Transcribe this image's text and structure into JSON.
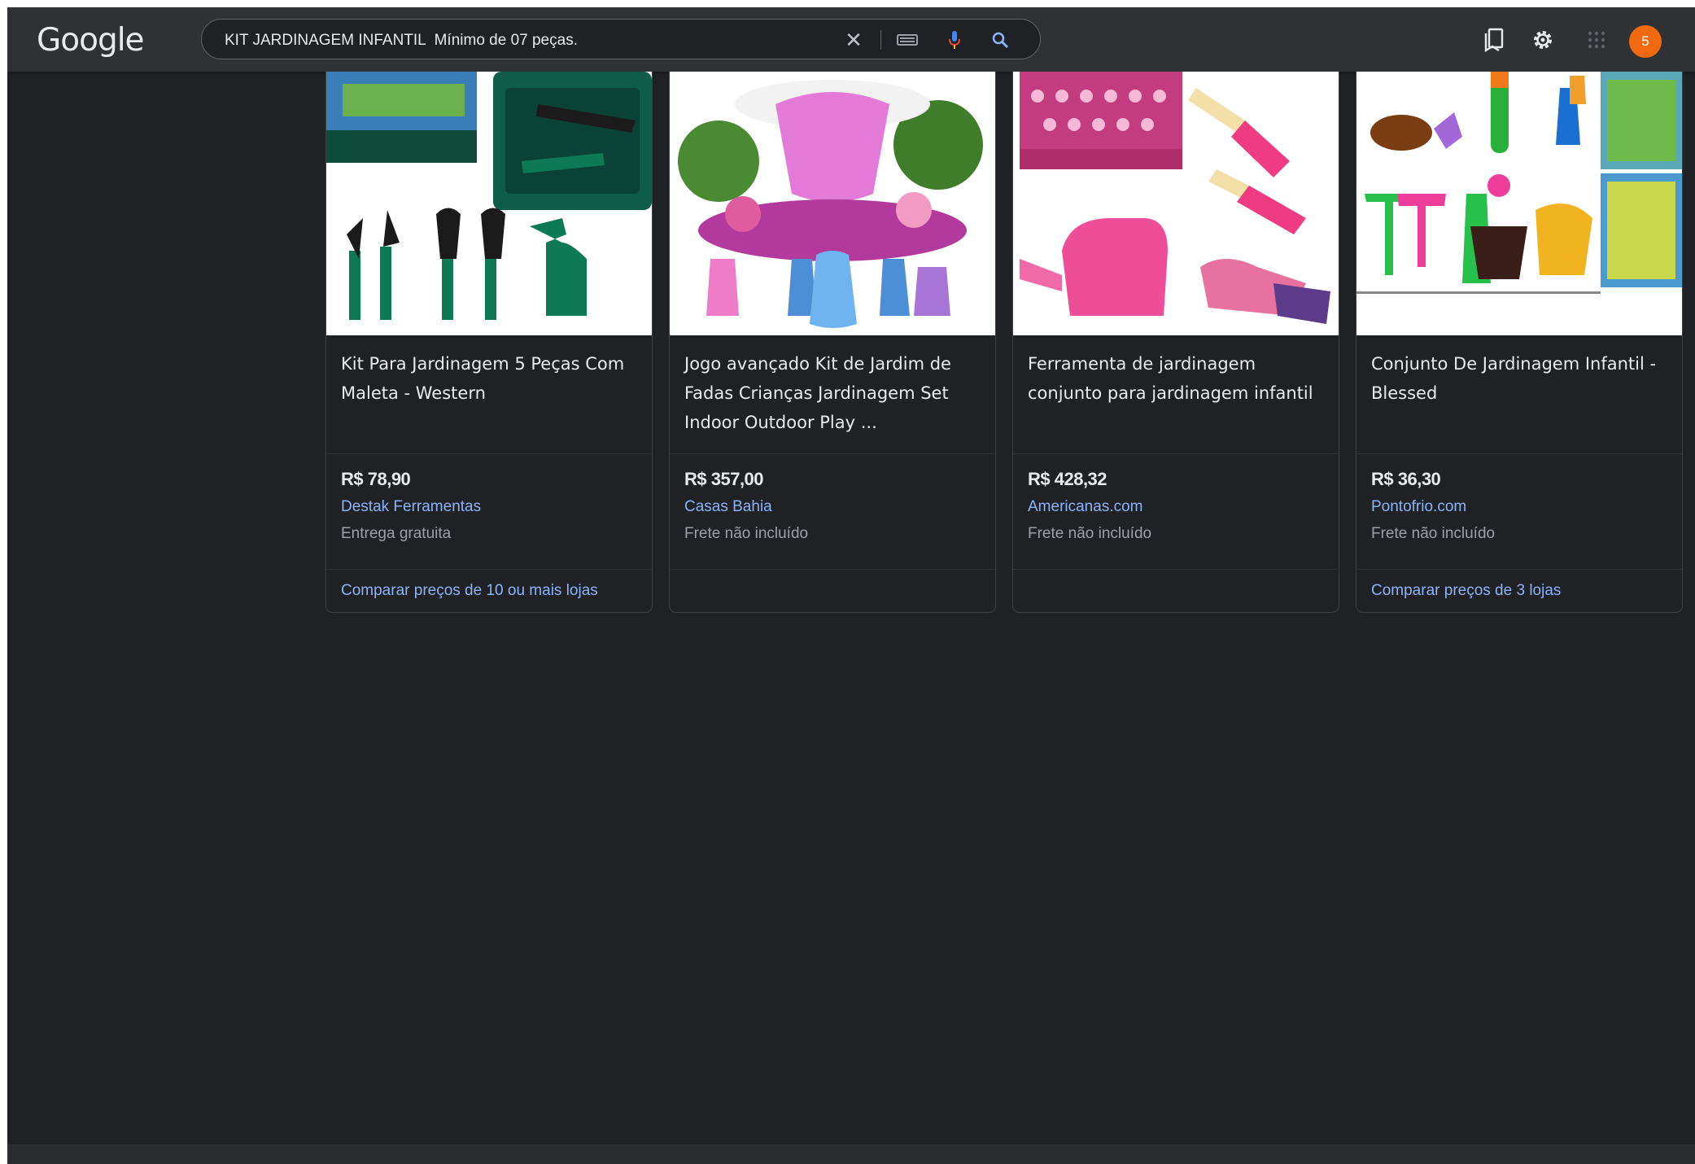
{
  "header": {
    "logo": "Google",
    "search_value": "KIT JARDINAGEM INFANTIL  Mínimo de 07 peças.",
    "avatar_letter": "5"
  },
  "colors": {
    "background": "#202124",
    "header": "#303134",
    "link": "#8ab4f8",
    "avatar": "#f0690f"
  },
  "icons": [
    "clear-icon",
    "keyboard-icon",
    "mic-icon",
    "search-icon",
    "saved-icon",
    "gear-icon",
    "apps-icon"
  ],
  "products": [
    {
      "title": "Kit Para Jardinagem 5 Peças Com Maleta - Western",
      "price": "R$ 78,90",
      "store": "Destak Ferramentas",
      "shipping": "Entrega gratuita",
      "compare": "Comparar preços de 10 ou mais lojas"
    },
    {
      "title": "Jogo avançado Kit de Jardim de Fadas Crianças Jardinagem Set Indoor Outdoor Play ...",
      "price": "R$ 357,00",
      "store": "Casas Bahia",
      "shipping": "Frete não incluído",
      "compare": ""
    },
    {
      "title": "Ferramenta de jardinagem conjunto para jardinagem infantil",
      "price": "R$ 428,32",
      "store": "Americanas.com",
      "shipping": "Frete não incluído",
      "compare": ""
    },
    {
      "title": "Conjunto De Jardinagem Infantil - Blessed",
      "price": "R$ 36,30",
      "store": "Pontofrio.com",
      "shipping": "Frete não incluído",
      "compare": "Comparar preços de 3 lojas"
    }
  ]
}
